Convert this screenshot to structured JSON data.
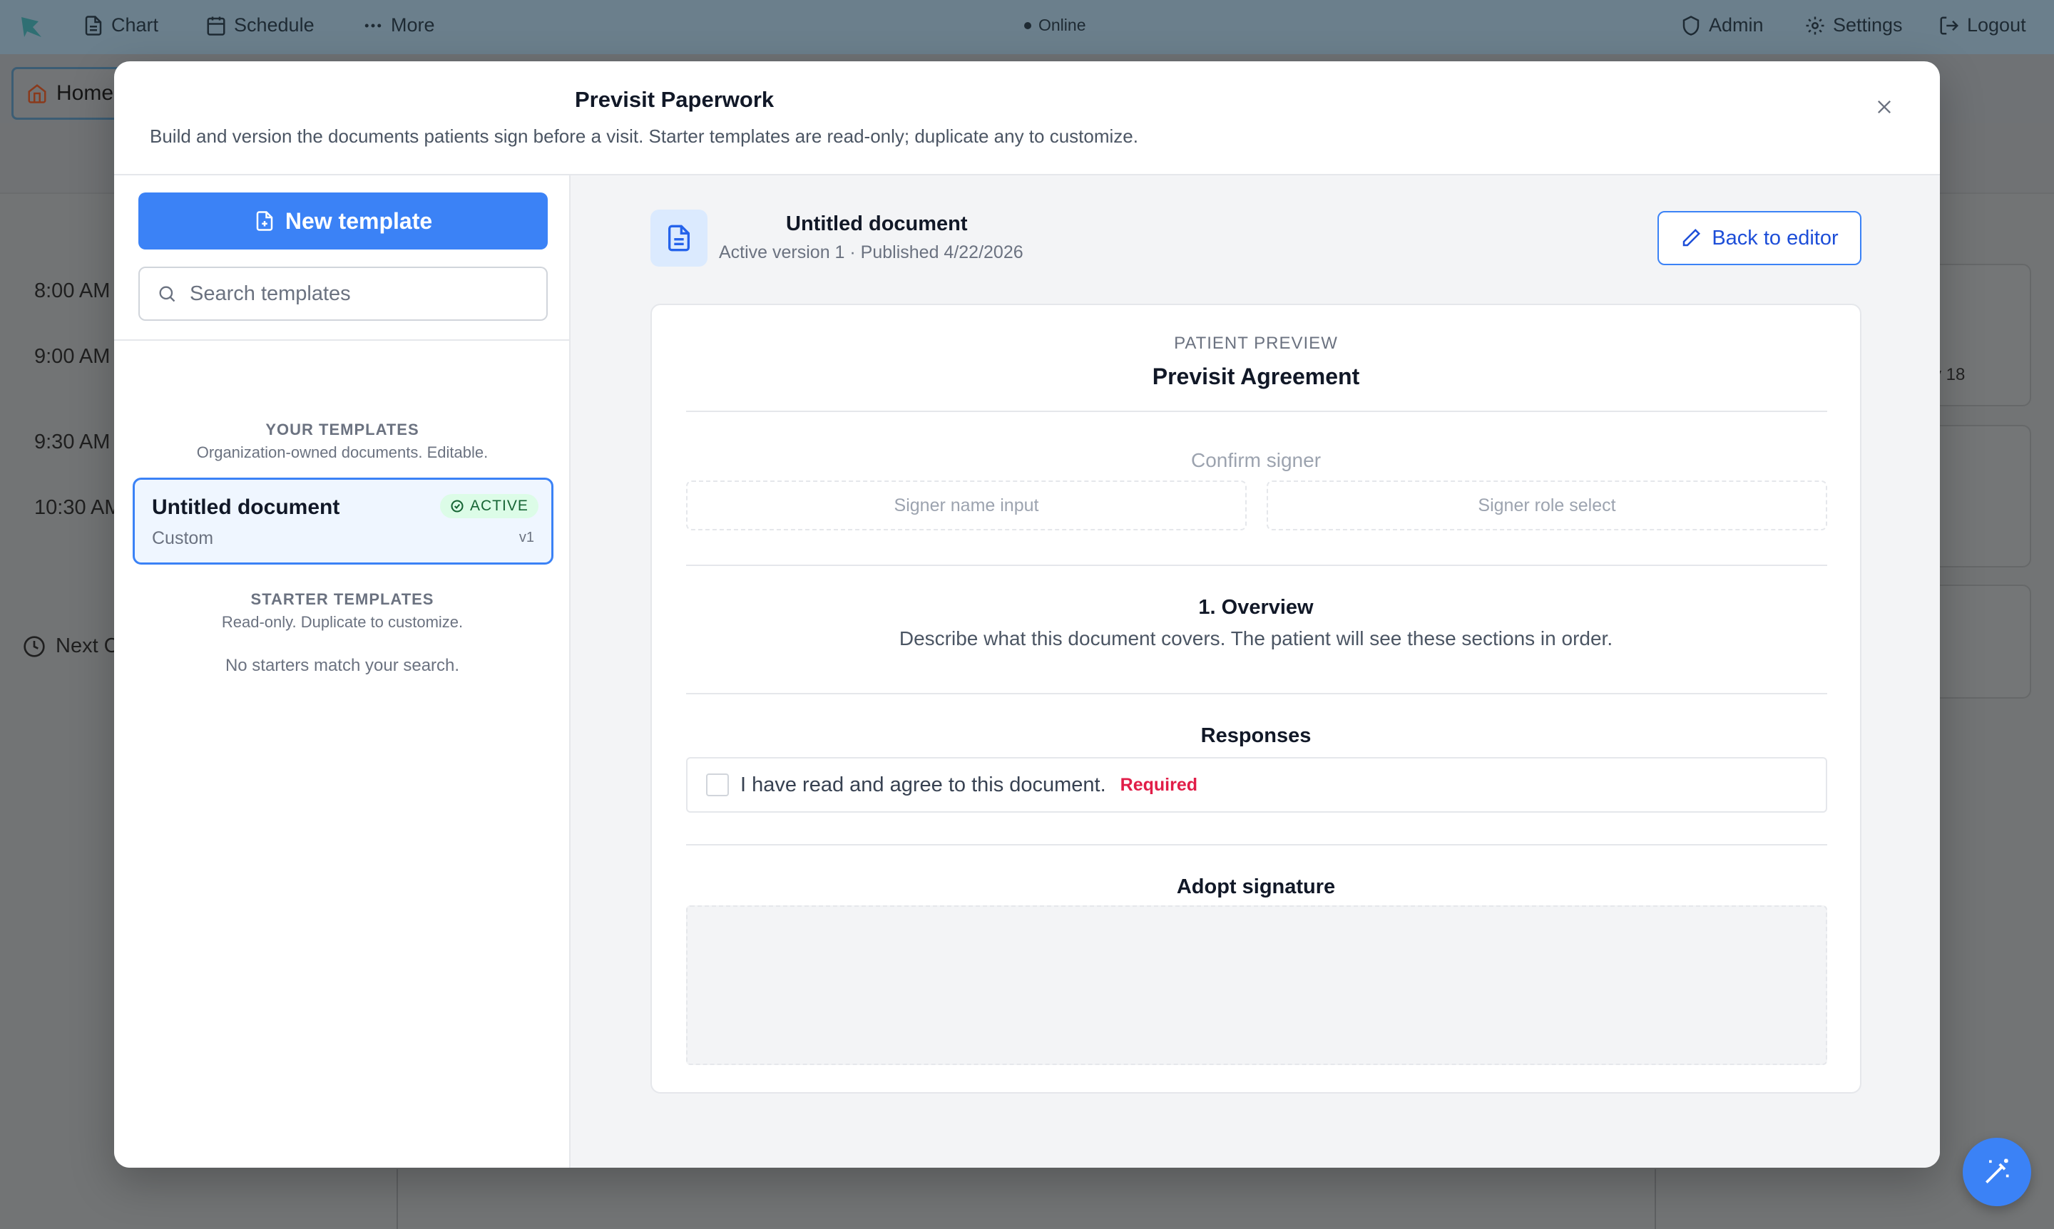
{
  "topnav": {
    "chart_label": "Chart",
    "schedule_label": "Schedule",
    "more_label": "More",
    "status_label": "Online",
    "admin_label": "Admin",
    "settings_label": "Settings",
    "logout_label": "Logout"
  },
  "background": {
    "home_tab_label": "Home",
    "times": [
      "8:00 AM",
      "9:00 AM",
      "9:30 AM",
      "10:30 AM"
    ],
    "next_label": "Next C",
    "right_date_fragment": "y 18"
  },
  "modal": {
    "title": "Previsit Paperwork",
    "subtitle": "Build and version the documents patients sign before a visit. Starter templates are read-only; duplicate any to customize."
  },
  "sidebar": {
    "new_template_label": "New template",
    "search_placeholder": "Search templates",
    "your_templates_heading": "YOUR TEMPLATES",
    "your_templates_sub": "Organization-owned documents. Editable.",
    "templates": [
      {
        "name": "Untitled document",
        "type": "Custom",
        "status": "ACTIVE",
        "version": "v1"
      }
    ],
    "starter_heading": "STARTER TEMPLATES",
    "starter_sub": "Read-only. Duplicate to customize.",
    "starter_empty": "No starters match your search."
  },
  "document": {
    "title": "Untitled document",
    "meta": "Active version 1 · Published 4/22/2026",
    "back_label": "Back to editor"
  },
  "preview": {
    "label": "PATIENT PREVIEW",
    "title": "Previsit Agreement",
    "confirm_label": "Confirm signer",
    "signer_name_label": "Signer name input",
    "signer_role_label": "Signer role select",
    "overview_heading": "1. Overview",
    "overview_body": "Describe what this document covers. The patient will see these sections in order.",
    "responses_heading": "Responses",
    "agree_text": "I have read and agree to this document.",
    "required_label": "Required",
    "signature_heading": "Adopt signature"
  },
  "colors": {
    "accent": "#3b82f6",
    "active_badge_bg": "#dcfce7",
    "required": "#e11d48"
  }
}
